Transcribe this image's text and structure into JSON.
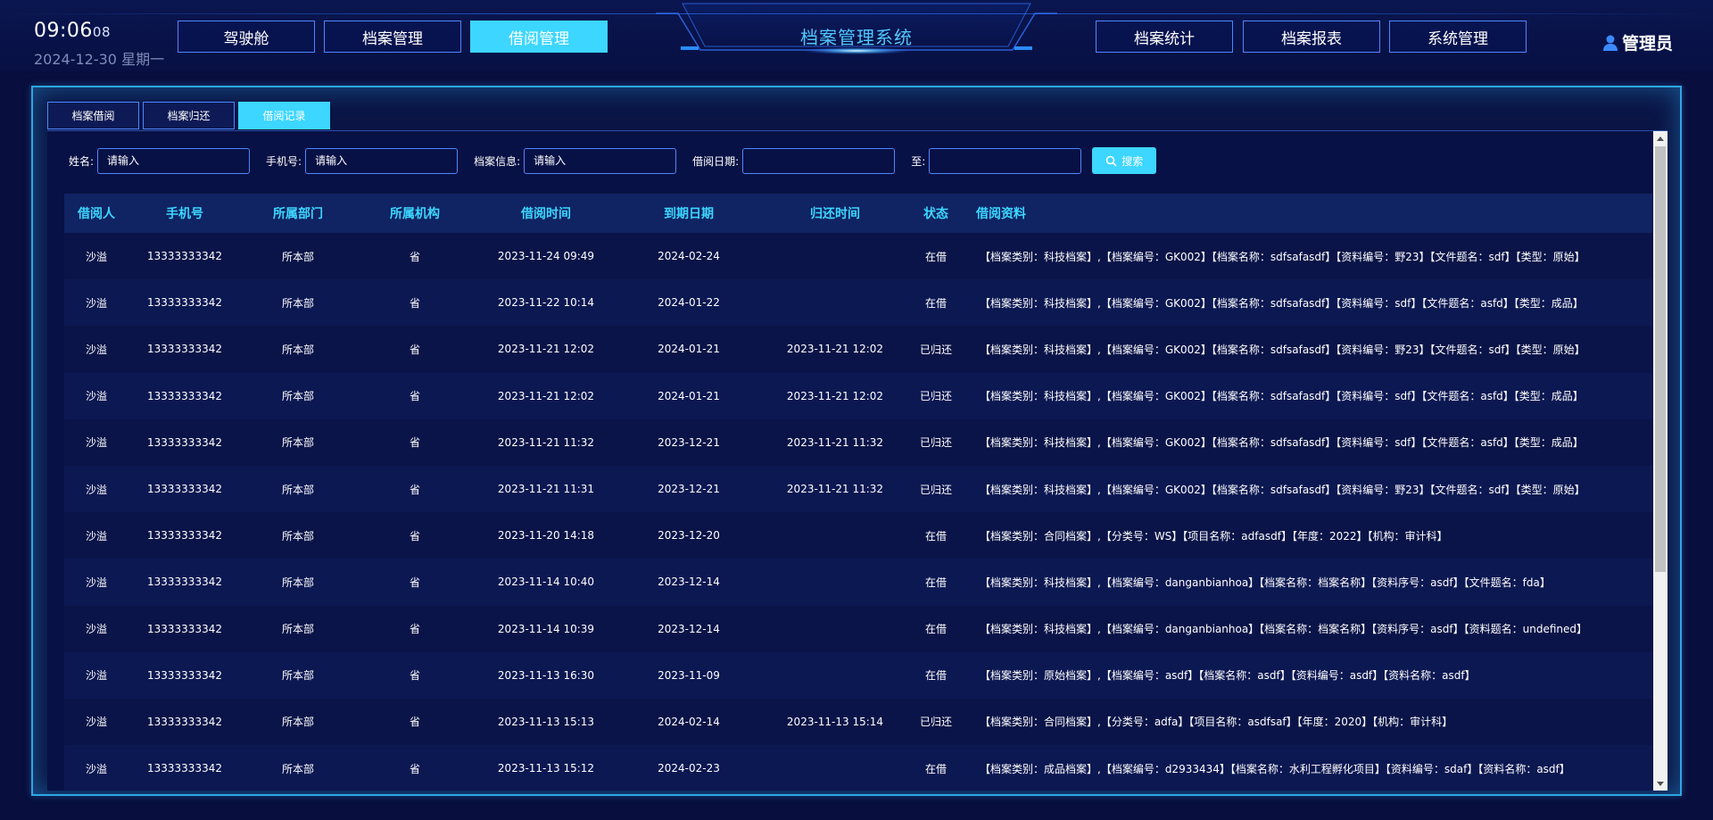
{
  "clock": {
    "time": "09:06",
    "seconds": "08",
    "date": "2024-12-30 星期一"
  },
  "nav_left": [
    {
      "label": "驾驶舱",
      "active": false
    },
    {
      "label": "档案管理",
      "active": false
    },
    {
      "label": "借阅管理",
      "active": true
    }
  ],
  "system_title": "档案管理系统",
  "nav_right": [
    {
      "label": "档案统计"
    },
    {
      "label": "档案报表"
    },
    {
      "label": "系统管理"
    }
  ],
  "user": {
    "name": "管理员",
    "icon": "user-icon"
  },
  "tabs": [
    {
      "label": "档案借阅",
      "active": false
    },
    {
      "label": "档案归还",
      "active": false
    },
    {
      "label": "借阅记录",
      "active": true
    }
  ],
  "search": {
    "name_label": "姓名:",
    "name_placeholder": "请输入",
    "phone_label": "手机号:",
    "phone_placeholder": "请输入",
    "archive_label": "档案信息:",
    "archive_placeholder": "请输入",
    "date_label": "借阅日期:",
    "to_label": "至:",
    "button_label": "搜索",
    "button_icon": "search-icon"
  },
  "table": {
    "headers": [
      "借阅人",
      "手机号",
      "所属部门",
      "所属机构",
      "借阅时间",
      "到期日期",
      "归还时间",
      "状态",
      "借阅资料"
    ],
    "rows": [
      [
        "沙溢",
        "13333333342",
        "所本部",
        "省",
        "2023-11-24 09:49",
        "2024-02-24",
        "",
        "在借",
        "【档案类别：科技档案】,【档案编号：GK002】【档案名称：sdfsafasdf】【资料编号：野23】【文件题名：sdf】【类型：原始】"
      ],
      [
        "沙溢",
        "13333333342",
        "所本部",
        "省",
        "2023-11-22 10:14",
        "2024-01-22",
        "",
        "在借",
        "【档案类别：科技档案】,【档案编号：GK002】【档案名称：sdfsafasdf】【资料编号：sdf】【文件题名：asfd】【类型：成品】"
      ],
      [
        "沙溢",
        "13333333342",
        "所本部",
        "省",
        "2023-11-21 12:02",
        "2024-01-21",
        "2023-11-21 12:02",
        "已归还",
        "【档案类别：科技档案】,【档案编号：GK002】【档案名称：sdfsafasdf】【资料编号：野23】【文件题名：sdf】【类型：原始】"
      ],
      [
        "沙溢",
        "13333333342",
        "所本部",
        "省",
        "2023-11-21 12:02",
        "2024-01-21",
        "2023-11-21 12:02",
        "已归还",
        "【档案类别：科技档案】,【档案编号：GK002】【档案名称：sdfsafasdf】【资料编号：sdf】【文件题名：asfd】【类型：成品】"
      ],
      [
        "沙溢",
        "13333333342",
        "所本部",
        "省",
        "2023-11-21 11:32",
        "2023-12-21",
        "2023-11-21 11:32",
        "已归还",
        "【档案类别：科技档案】,【档案编号：GK002】【档案名称：sdfsafasdf】【资料编号：sdf】【文件题名：asfd】【类型：成品】"
      ],
      [
        "沙溢",
        "13333333342",
        "所本部",
        "省",
        "2023-11-21 11:31",
        "2023-12-21",
        "2023-11-21 11:32",
        "已归还",
        "【档案类别：科技档案】,【档案编号：GK002】【档案名称：sdfsafasdf】【资料编号：野23】【文件题名：sdf】【类型：原始】"
      ],
      [
        "沙溢",
        "13333333342",
        "所本部",
        "省",
        "2023-11-20 14:18",
        "2023-12-20",
        "",
        "在借",
        "【档案类别：合同档案】,【分类号：WS】【项目名称：adfasdf】【年度：2022】【机构：审计科】"
      ],
      [
        "沙溢",
        "13333333342",
        "所本部",
        "省",
        "2023-11-14 10:40",
        "2023-12-14",
        "",
        "在借",
        "【档案类别：科技档案】,【档案编号：danganbianhoa】【档案名称：档案名称】【资料序号：asdf】【文件题名：fda】"
      ],
      [
        "沙溢",
        "13333333342",
        "所本部",
        "省",
        "2023-11-14 10:39",
        "2023-12-14",
        "",
        "在借",
        "【档案类别：科技档案】,【档案编号：danganbianhoa】【档案名称：档案名称】【资料序号：asdf】【资料题名：undefined】"
      ],
      [
        "沙溢",
        "13333333342",
        "所本部",
        "省",
        "2023-11-13 16:30",
        "2023-11-09",
        "",
        "在借",
        "【档案类别：原始档案】,【档案编号：asdf】【档案名称：asdf】【资料编号：asdf】【资料名称：asdf】"
      ],
      [
        "沙溢",
        "13333333342",
        "所本部",
        "省",
        "2023-11-13 15:13",
        "2024-02-14",
        "2023-11-13 15:14",
        "已归还",
        "【档案类别：合同档案】,【分类号：adfa】【项目名称：asdfsaf】【年度：2020】【机构：审计科】"
      ],
      [
        "沙溢",
        "13333333342",
        "所本部",
        "省",
        "2023-11-13 15:12",
        "2024-02-23",
        "",
        "在借",
        "【档案类别：成品档案】,【档案编号：d2933434】【档案名称：水利工程孵化项目】【资料编号：sdaf】【资料名称：asdf】"
      ]
    ]
  },
  "colors": {
    "background": "#080e3d",
    "accent": "#3cd6ff",
    "border": "#4f86ff",
    "title": "#51c8ff"
  }
}
